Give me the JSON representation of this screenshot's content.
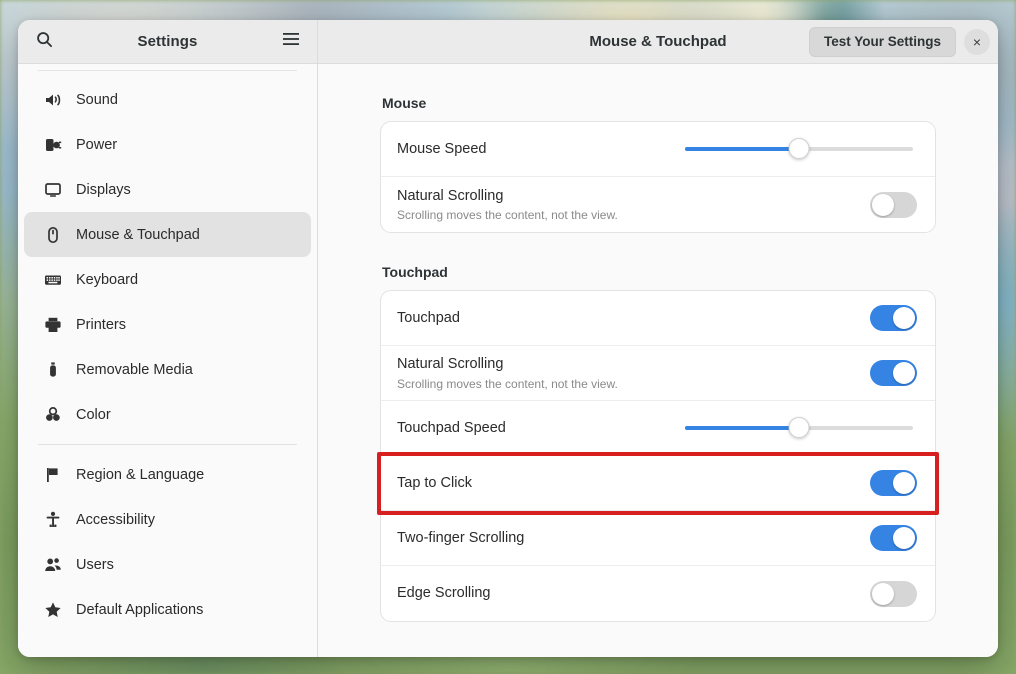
{
  "window": {
    "app_title": "Settings",
    "panel_title": "Mouse & Touchpad",
    "test_button": "Test Your Settings",
    "close_label": "×",
    "search_icon": "search-icon",
    "menu_icon": "hamburger-menu-icon"
  },
  "sidebar": {
    "items": [
      {
        "label": "Sound",
        "icon": "speaker-icon",
        "selected": false
      },
      {
        "label": "Power",
        "icon": "power-plug-icon",
        "selected": false
      },
      {
        "label": "Displays",
        "icon": "monitor-icon",
        "selected": false
      },
      {
        "label": "Mouse & Touchpad",
        "icon": "mouse-icon",
        "selected": true
      },
      {
        "label": "Keyboard",
        "icon": "keyboard-icon",
        "selected": false
      },
      {
        "label": "Printers",
        "icon": "printer-icon",
        "selected": false
      },
      {
        "label": "Removable Media",
        "icon": "usb-drive-icon",
        "selected": false
      },
      {
        "label": "Color",
        "icon": "color-circles-icon",
        "selected": false
      }
    ],
    "items_lower": [
      {
        "label": "Region & Language",
        "icon": "flag-icon",
        "selected": false
      },
      {
        "label": "Accessibility",
        "icon": "accessibility-icon",
        "selected": false
      },
      {
        "label": "Users",
        "icon": "users-icon",
        "selected": false
      },
      {
        "label": "Default Applications",
        "icon": "star-icon",
        "selected": false
      }
    ]
  },
  "main": {
    "mouse": {
      "group_title": "Mouse",
      "speed_label": "Mouse Speed",
      "speed_value": 50,
      "natural_scrolling_label": "Natural Scrolling",
      "natural_scrolling_sub": "Scrolling moves the content, not the view.",
      "natural_scrolling_on": false
    },
    "touchpad": {
      "group_title": "Touchpad",
      "touchpad_label": "Touchpad",
      "touchpad_on": true,
      "natural_scrolling_label": "Natural Scrolling",
      "natural_scrolling_sub": "Scrolling moves the content, not the view.",
      "natural_scrolling_on": true,
      "speed_label": "Touchpad Speed",
      "speed_value": 50,
      "tap_to_click_label": "Tap to Click",
      "tap_to_click_on": true,
      "two_finger_scrolling_label": "Two-finger Scrolling",
      "two_finger_scrolling_on": true,
      "edge_scrolling_label": "Edge Scrolling",
      "edge_scrolling_on": false
    }
  },
  "annotation": {
    "highlight_target": "Tap to Click",
    "highlight_color": "#d81f1f"
  },
  "colors": {
    "accent": "#3584e4",
    "toggle_off": "#d6d6d6",
    "window_bg": "#fafafa",
    "card_bg": "#ffffff",
    "header_bg": "#ebebeb"
  }
}
